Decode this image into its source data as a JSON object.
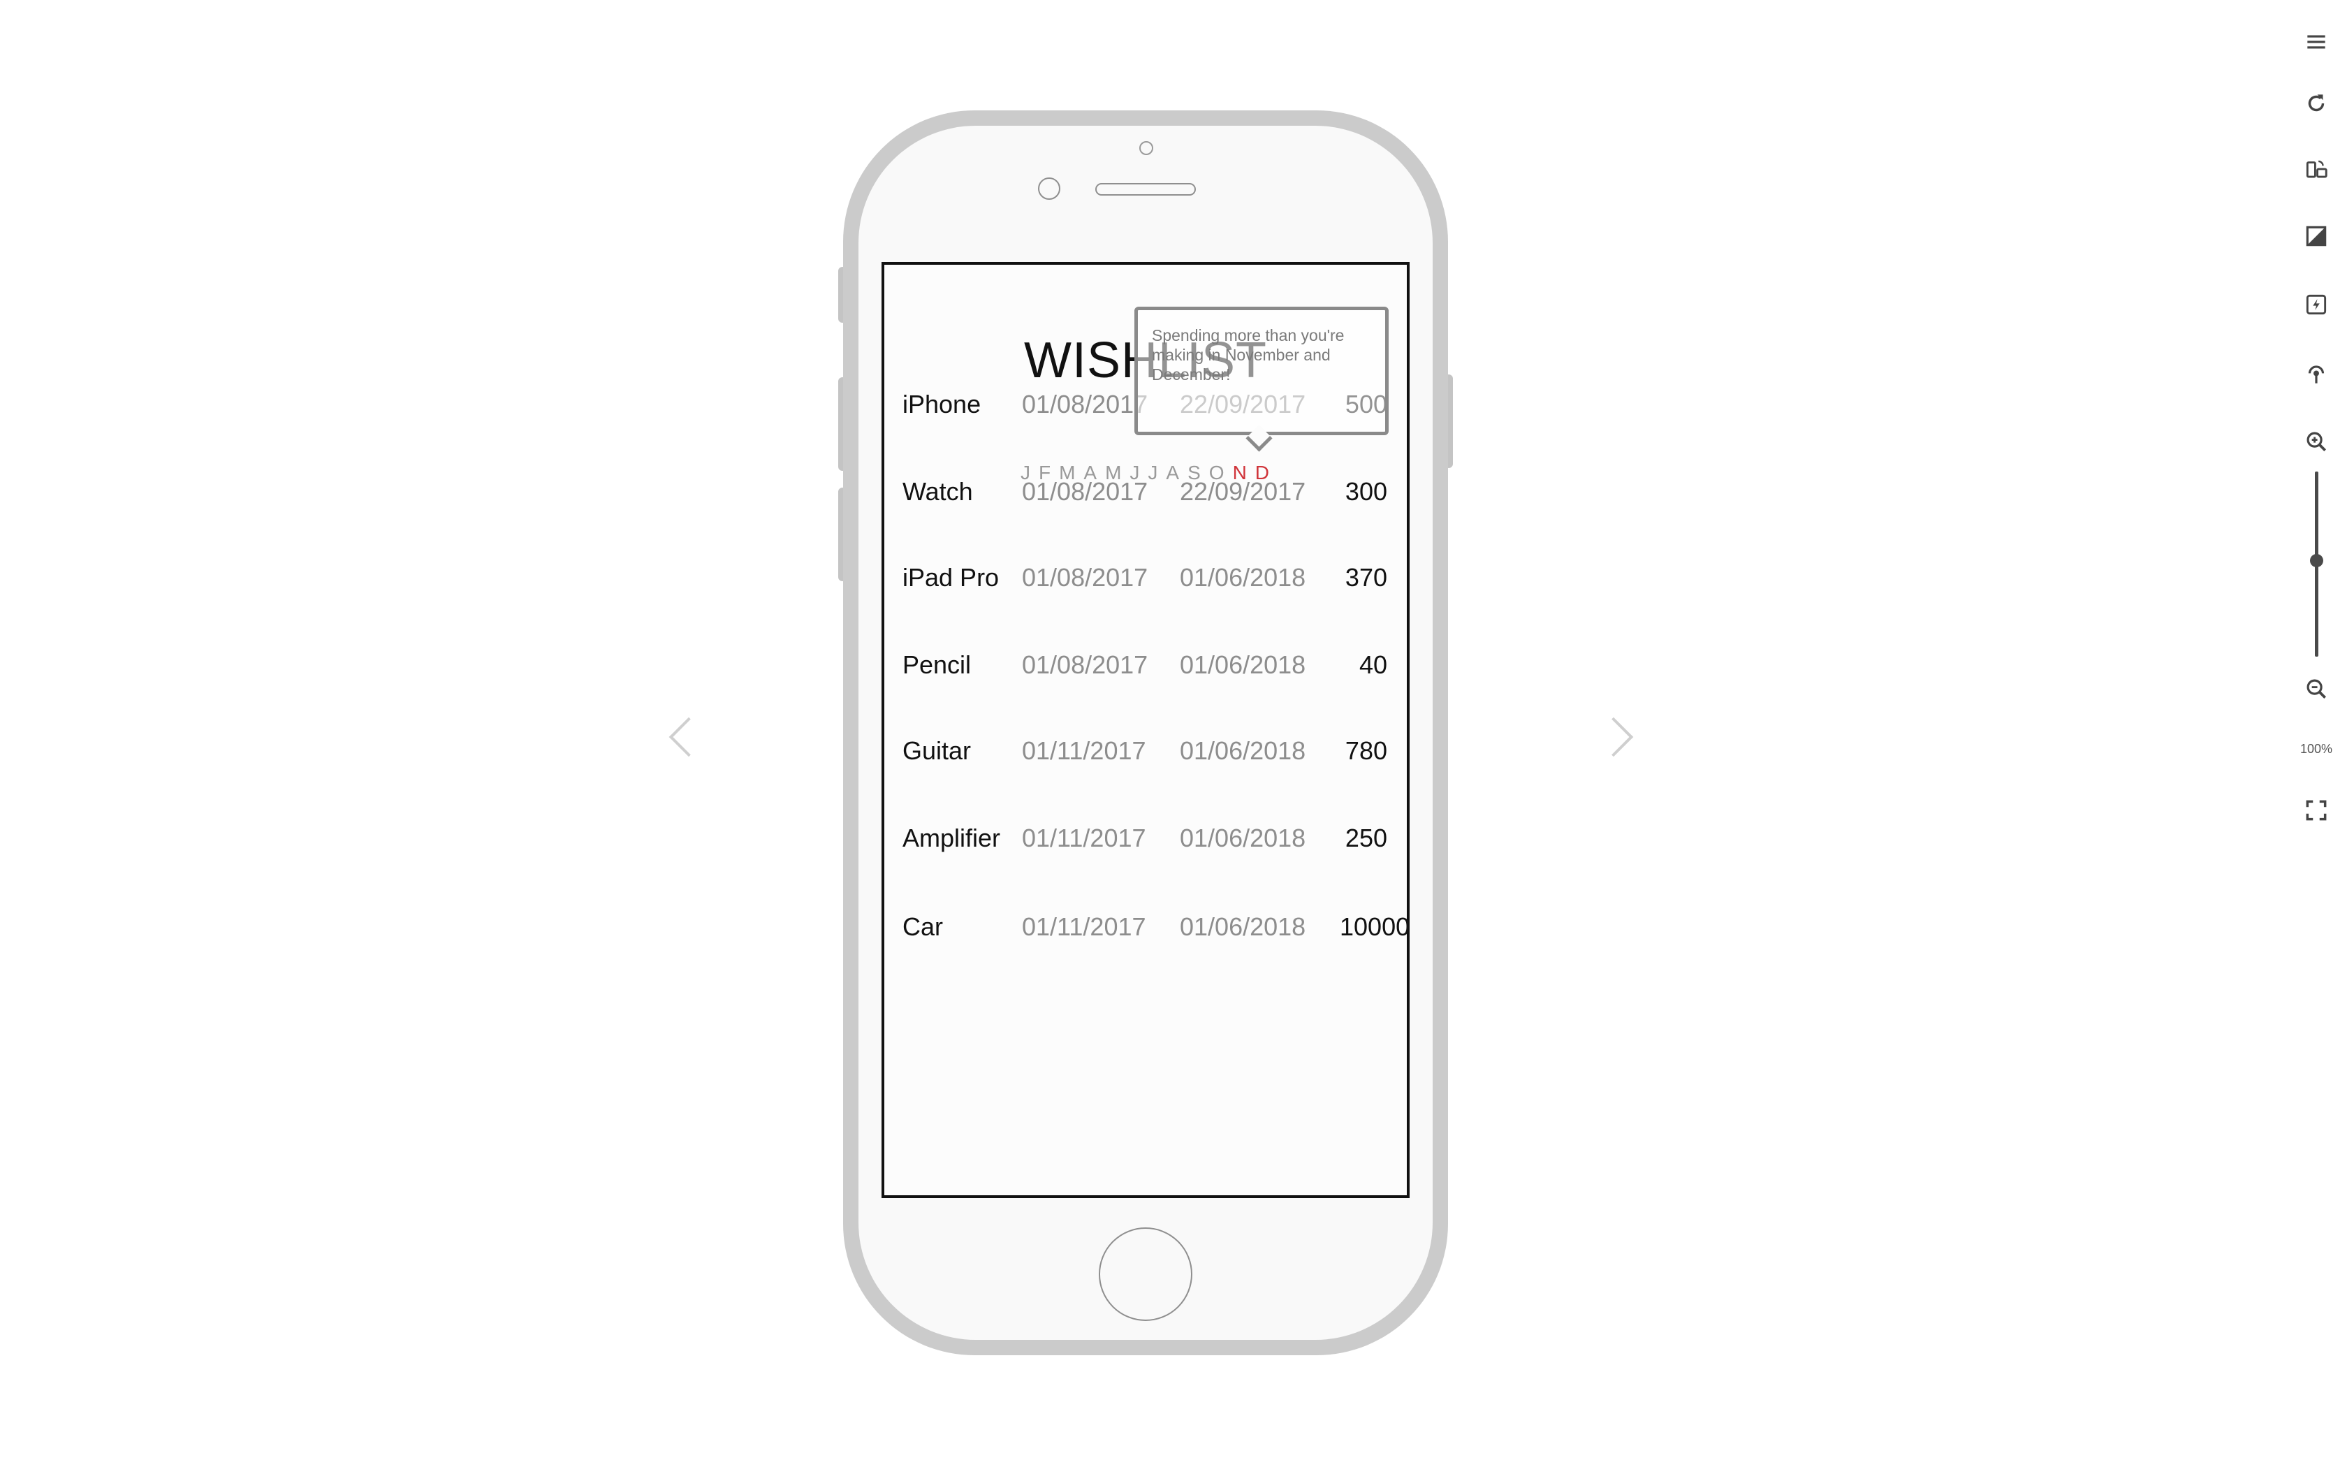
{
  "screen": {
    "title": "WISHLIST",
    "months": [
      "J",
      "F",
      "M",
      "A",
      "M",
      "J",
      "J",
      "A",
      "S",
      "O",
      "N",
      "D"
    ],
    "highlight_months": [
      10,
      11
    ],
    "highlight_color": "#d0343a",
    "tooltip": {
      "text": "Spending more than you're making in November and December!"
    },
    "items": [
      {
        "name": "iPhone",
        "start": "01/08/2017",
        "end": "22/09/2017",
        "amount": "500"
      },
      {
        "name": "Watch",
        "start": "01/08/2017",
        "end": "22/09/2017",
        "amount": "300"
      },
      {
        "name": "iPad Pro",
        "start": "01/08/2017",
        "end": "01/06/2018",
        "amount": "370"
      },
      {
        "name": "Pencil",
        "start": "01/08/2017",
        "end": "01/06/2018",
        "amount": "40"
      },
      {
        "name": "Guitar",
        "start": "01/11/2017",
        "end": "01/06/2018",
        "amount": "780"
      },
      {
        "name": "Amplifier",
        "start": "01/11/2017",
        "end": "01/06/2018",
        "amount": "250"
      },
      {
        "name": "Car",
        "start": "01/11/2017",
        "end": "01/06/2018",
        "amount": "10000"
      }
    ]
  },
  "toolbar": {
    "icons": [
      "menu-icon",
      "refresh-icon",
      "rotate-device-icon",
      "contrast-icon",
      "flash-icon",
      "touch-icon",
      "zoom-in-icon",
      "zoom-out-icon",
      "fullscreen-icon"
    ],
    "zoom_label": "100%",
    "zoom_level_percent": 48
  },
  "navigation": {
    "prev_icon": "chevron-left-icon",
    "next_icon": "chevron-right-icon"
  }
}
